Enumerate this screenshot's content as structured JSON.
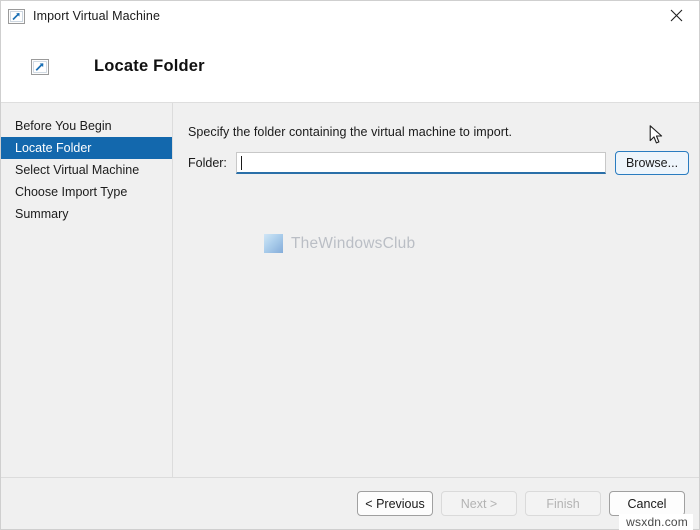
{
  "window": {
    "title": "Import Virtual Machine",
    "title_icon": "import-vm-icon",
    "close_icon": "close-icon"
  },
  "header": {
    "title": "Locate Folder",
    "icon": "import-vm-icon"
  },
  "sidebar": {
    "items": [
      {
        "label": "Before You Begin",
        "selected": false
      },
      {
        "label": "Locate Folder",
        "selected": true
      },
      {
        "label": "Select Virtual Machine",
        "selected": false
      },
      {
        "label": "Choose Import Type",
        "selected": false
      },
      {
        "label": "Summary",
        "selected": false
      }
    ],
    "selected_bg": "#1368ad",
    "selected_fg": "#ffffff"
  },
  "main": {
    "instruction": "Specify the folder containing the virtual machine to import.",
    "folder_label": "Folder:",
    "folder_value": "",
    "folder_placeholder": "",
    "browse_label": "Browse...",
    "focus_accent": "#2a6fa8",
    "browse_border": "#2a7cc0"
  },
  "watermark": {
    "text": "TheWindowsClub",
    "logo_icon": "windows-club-logo-icon",
    "color": "#b8bcc3"
  },
  "footer": {
    "buttons": [
      {
        "label": "< Previous",
        "state": "enabled"
      },
      {
        "label": "Next >",
        "state": "disabled"
      },
      {
        "label": "Finish",
        "state": "disabled"
      },
      {
        "label": "Cancel",
        "state": "enabled"
      }
    ],
    "site_watermark": "wsxdn.com"
  }
}
